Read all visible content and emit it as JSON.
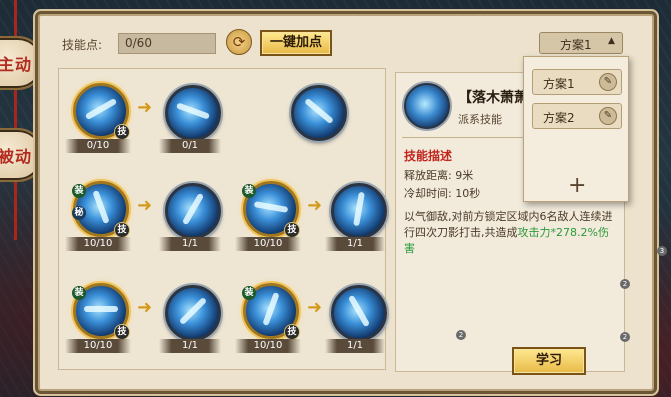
{
  "sidebar": {
    "tab_active": "主动",
    "tab_passive": "被动"
  },
  "header": {
    "points_label": "技能点:",
    "points_value": "0/60",
    "one_click_label": "一键加点",
    "plan_selected": "方案1",
    "plan_caret": "▲"
  },
  "plans": {
    "items": [
      {
        "label": "方案1"
      },
      {
        "label": "方案2"
      }
    ],
    "add_label": "+"
  },
  "tree": {
    "rows": [
      {
        "a": {
          "count": "0/10",
          "tag": "技"
        },
        "b": {
          "count": "0/1"
        },
        "c": {}
      },
      {
        "a": {
          "count": "10/10",
          "tag": "技",
          "tag2": "装",
          "tag3": "秘"
        },
        "b": {
          "count": "1/1"
        },
        "c": {
          "count": "10/10",
          "tag": "技",
          "tag2": "装"
        },
        "d": {
          "count": "1/1"
        }
      },
      {
        "a": {
          "count": "10/10",
          "tag": "技",
          "tag2": "装"
        },
        "b": {
          "count": "1/1"
        },
        "c": {
          "count": "10/10",
          "tag": "技",
          "tag2": "装"
        },
        "d": {
          "count": "1/1"
        }
      }
    ],
    "arrow": "➜"
  },
  "detail": {
    "name": "【落木萧萧",
    "type": "派系技能",
    "desc_title": "技能描述",
    "range": "释放距离: 9米",
    "cooldown": "冷却时间: 10秒",
    "desc_main": "以气御敌,对前方锁定区域内6名敌人连续进行四次刀影打击,共造成",
    "desc_highlight": "攻击力*278.2%伤害",
    "learn_label": "学习"
  },
  "badges": {
    "b1": "2",
    "b2": "2",
    "b3": "2",
    "b4": "3"
  },
  "colors": {
    "accent_red": "#c0261e",
    "gold": "#e7b946",
    "highlight_green": "#2b9a3c"
  }
}
